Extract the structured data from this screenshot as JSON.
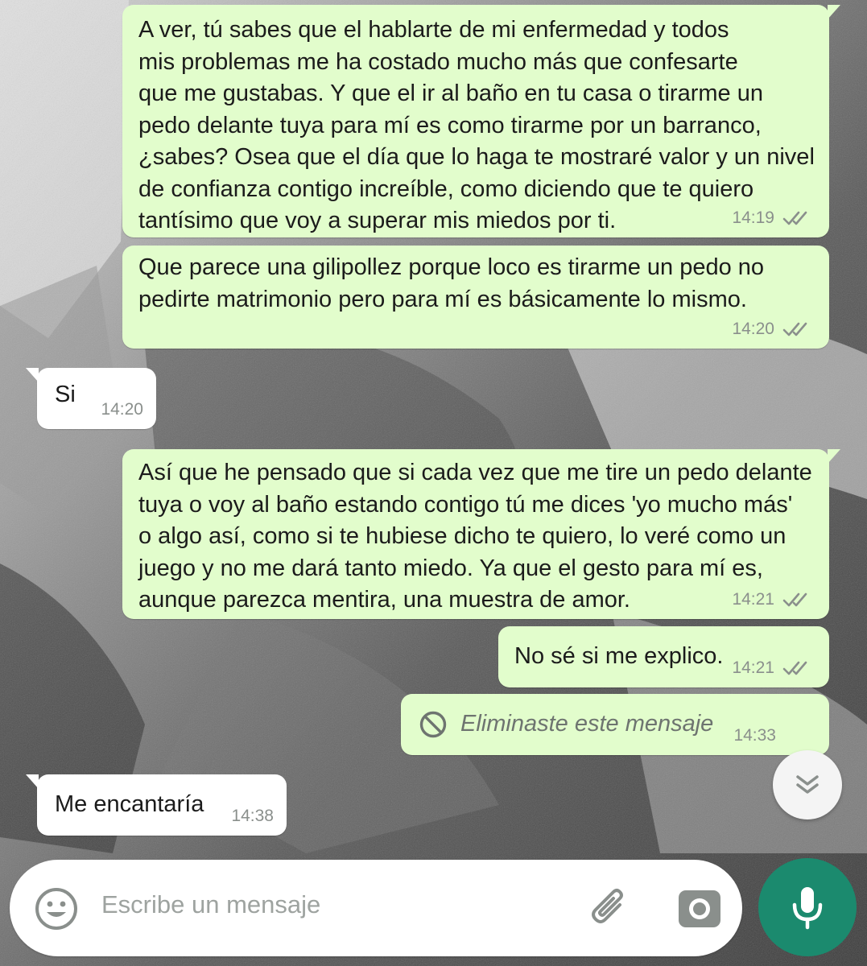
{
  "messages": [
    {
      "direction": "outgoing",
      "text": "A ver, tú sabes que el hablarte de mi enfermedad y todos\nmis problemas me ha costado mucho más que confesarte\nque me gustabas. Y que el ir al baño en tu casa o tirarme un\npedo delante tuya para mí es como tirarme por un barranco,\n¿sabes? Osea que el día que lo haga te mostraré valor y un nivel\nde confianza contigo increíble, como diciendo que te quiero\ntantísimo que voy a superar mis miedos por ti.",
      "time": "14:19",
      "status": "read"
    },
    {
      "direction": "outgoing",
      "text": "Que parece una gilipollez porque loco es tirarme un pedo no\npedirte matrimonio pero para mí es básicamente lo mismo.",
      "time": "14:20",
      "status": "read"
    },
    {
      "direction": "incoming",
      "text": "Si",
      "time": "14:20"
    },
    {
      "direction": "outgoing",
      "text": "Así que he pensado que si cada vez que me tire un pedo delante\ntuya o voy al baño estando contigo tú me dices 'yo mucho más'\no algo así, como si te hubiese dicho te quiero, lo veré como un\njuego y no me dará tanto miedo. Ya que el gesto para mí es,\naunque parezca mentira, una muestra de amor.",
      "time": "14:21",
      "status": "read"
    },
    {
      "direction": "outgoing",
      "text": "No sé si me explico.",
      "time": "14:21",
      "status": "read"
    },
    {
      "direction": "outgoing",
      "deleted": true,
      "text": "Eliminaste este mensaje",
      "time": "14:33"
    },
    {
      "direction": "incoming",
      "text": "Me encantaría",
      "time": "14:38"
    }
  ],
  "composer": {
    "placeholder": "Escribe un mensaje",
    "emoji_icon": "emoji-icon",
    "attach_icon": "paperclip-icon",
    "camera_icon": "camera-icon",
    "mic_icon": "microphone-icon"
  },
  "scroll_button_icon": "double-chevron-down-icon",
  "colors": {
    "outgoing_bubble": "#e2fdcc",
    "incoming_bubble": "#ffffff",
    "mic_button": "#1b8a6e",
    "timestamp": "#8a8f8c"
  }
}
